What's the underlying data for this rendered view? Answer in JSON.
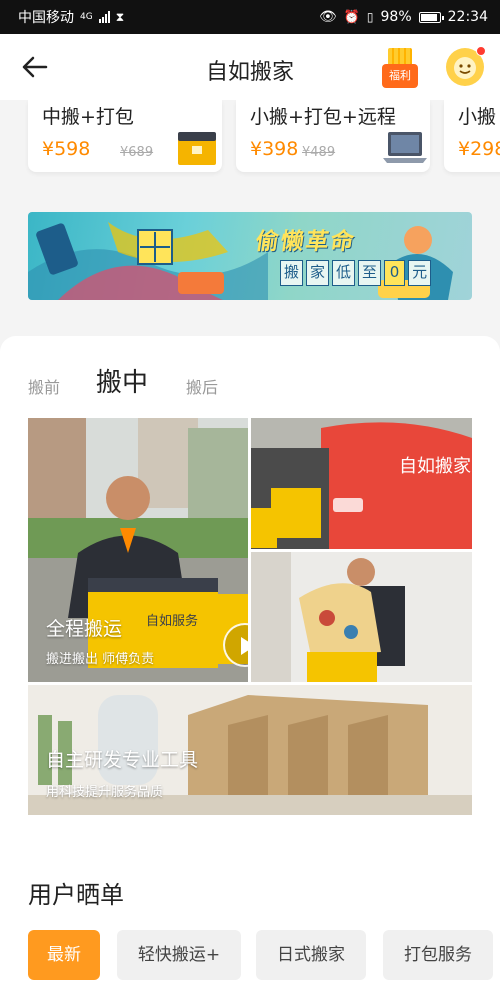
{
  "status_bar": {
    "carrier": "中国移动",
    "network": "4G",
    "battery": "98%",
    "battery_level": 0.98,
    "time": "22:34"
  },
  "nav": {
    "title": "自如搬家",
    "welfare_label": "福利"
  },
  "packages": [
    {
      "name": "中搬+打包",
      "price": "¥598",
      "original_price": "¥689"
    },
    {
      "name": "小搬+打包+远程",
      "price": "¥398",
      "original_price": "¥489"
    },
    {
      "name": "小搬",
      "price": "¥298"
    }
  ],
  "banner": {
    "slogan": "偷懒革命",
    "sub_chars": [
      "搬",
      "家",
      "低",
      "至",
      "0",
      "元"
    ]
  },
  "stage_tabs": [
    {
      "label": "搬前",
      "active": false
    },
    {
      "label": "搬中",
      "active": true
    },
    {
      "label": "搬后",
      "active": false
    }
  ],
  "features": [
    {
      "title": "全程搬运",
      "subtitle": "搬进搬出 师傅负责"
    },
    {
      "title": "自主研发专业工具",
      "subtitle": "用科技提升服务品质"
    }
  ],
  "photo_text": {
    "box_brand": "自如服务",
    "van_brand": "自如搬家"
  },
  "user_reviews": {
    "title": "用户晒单",
    "filters": [
      {
        "label": "最新",
        "active": true
      },
      {
        "label": "轻快搬运+",
        "active": false
      },
      {
        "label": "日式搬家",
        "active": false
      },
      {
        "label": "打包服务",
        "active": false
      }
    ]
  },
  "colors": {
    "accent": "#ff9a1f",
    "price": "#ff8a00",
    "van_red": "#e8473a",
    "box_yellow": "#f5c400"
  }
}
